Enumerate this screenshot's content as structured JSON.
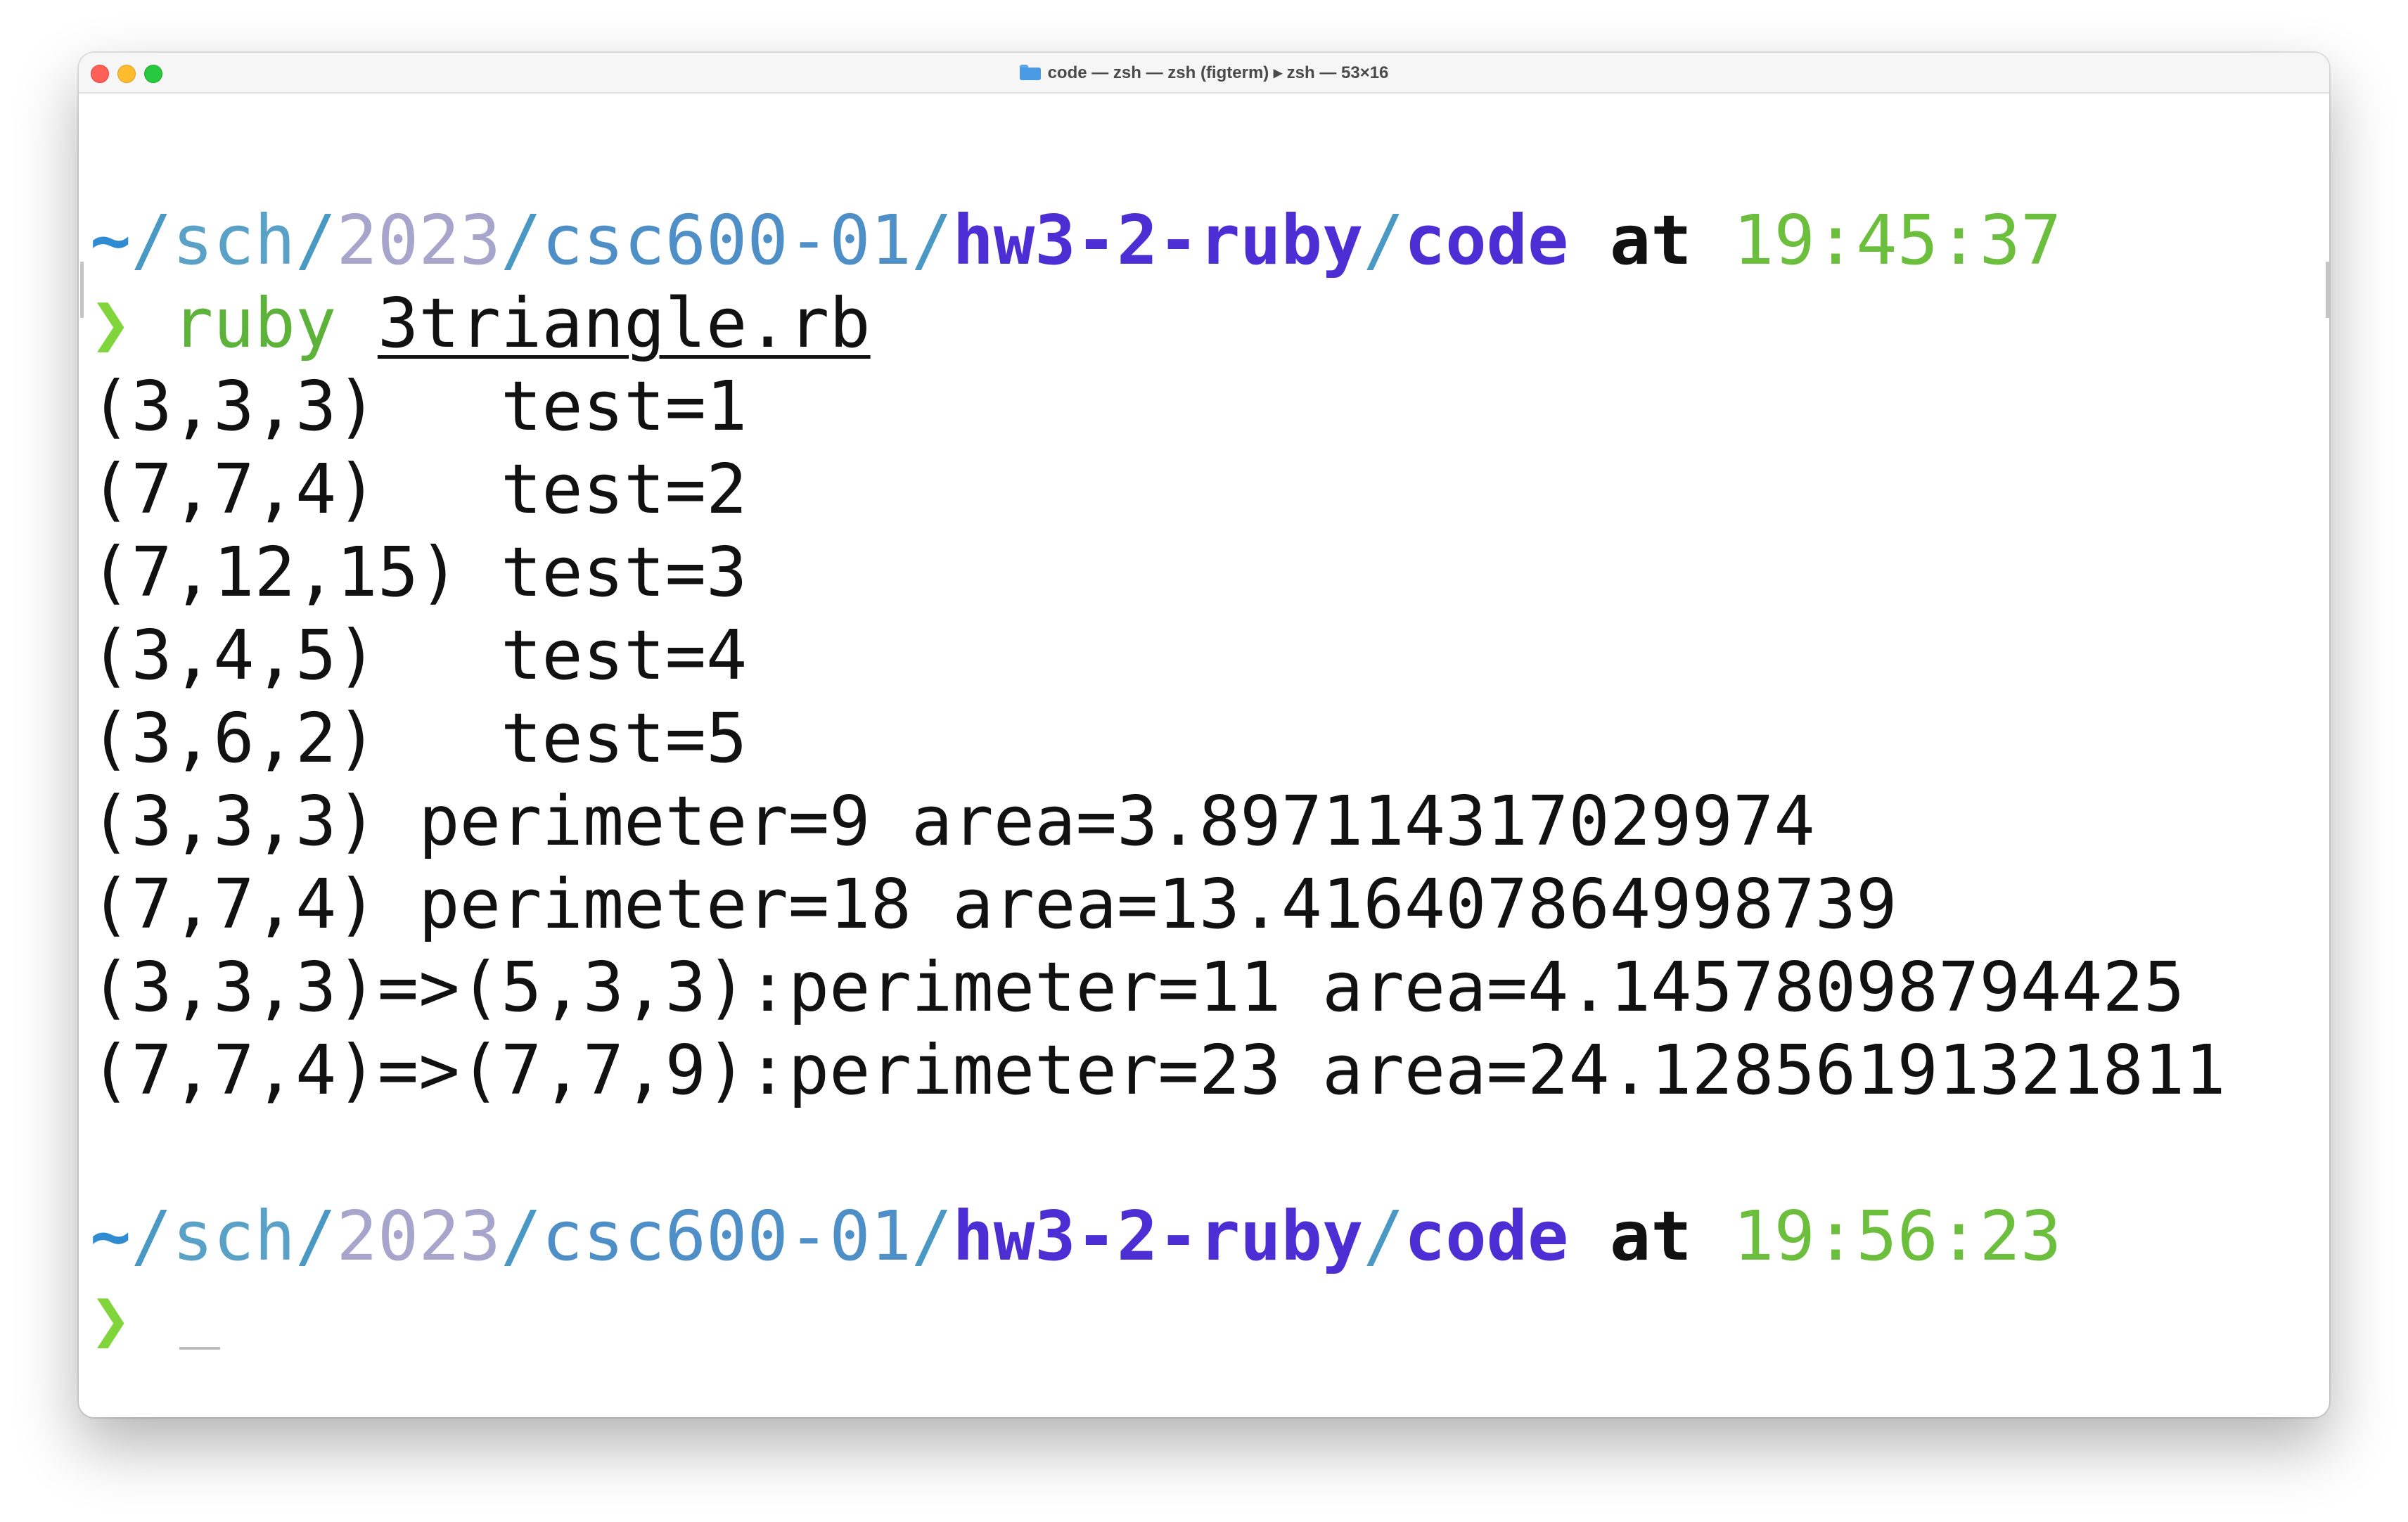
{
  "window": {
    "title": "code — zsh — zsh (figterm) ▸ zsh — 53×16"
  },
  "prompt1": {
    "tilde": "~",
    "s1": "/",
    "sch": "sch",
    "s2": "/",
    "year": "2023",
    "s3": "/",
    "course": "csc600-01",
    "s4": "/",
    "hw": "hw3-2-ruby",
    "s5": "/",
    "dir": "code",
    "at": "at",
    "time": "19:45:37"
  },
  "command": {
    "prompt_char": "❯",
    "name": "ruby",
    "arg": "3triangle.rb"
  },
  "output": [
    "(3,3,3)   test=1",
    "(7,7,4)   test=2",
    "(7,12,15) test=3",
    "(3,4,5)   test=4",
    "(3,6,2)   test=5",
    "(3,3,3) perimeter=9 area=3.897114317029974",
    "(7,7,4) perimeter=18 area=13.416407864998739",
    "(3,3,3)=>(5,3,3):perimeter=11 area=4.14578098794425",
    "(7,7,4)=>(7,7,9):perimeter=23 area=24.12856191321811"
  ],
  "prompt2": {
    "tilde": "~",
    "s1": "/",
    "sch": "sch",
    "s2": "/",
    "year": "2023",
    "s3": "/",
    "course": "csc600-01",
    "s4": "/",
    "hw": "hw3-2-ruby",
    "s5": "/",
    "dir": "code",
    "at": "at",
    "time": "19:56:23",
    "prompt_char": "❯"
  },
  "colors": {
    "prompt_char": "#7fd53a",
    "path_bold": "#4b2fd5",
    "time": "#6cbf3c",
    "command": "#5db33a"
  }
}
